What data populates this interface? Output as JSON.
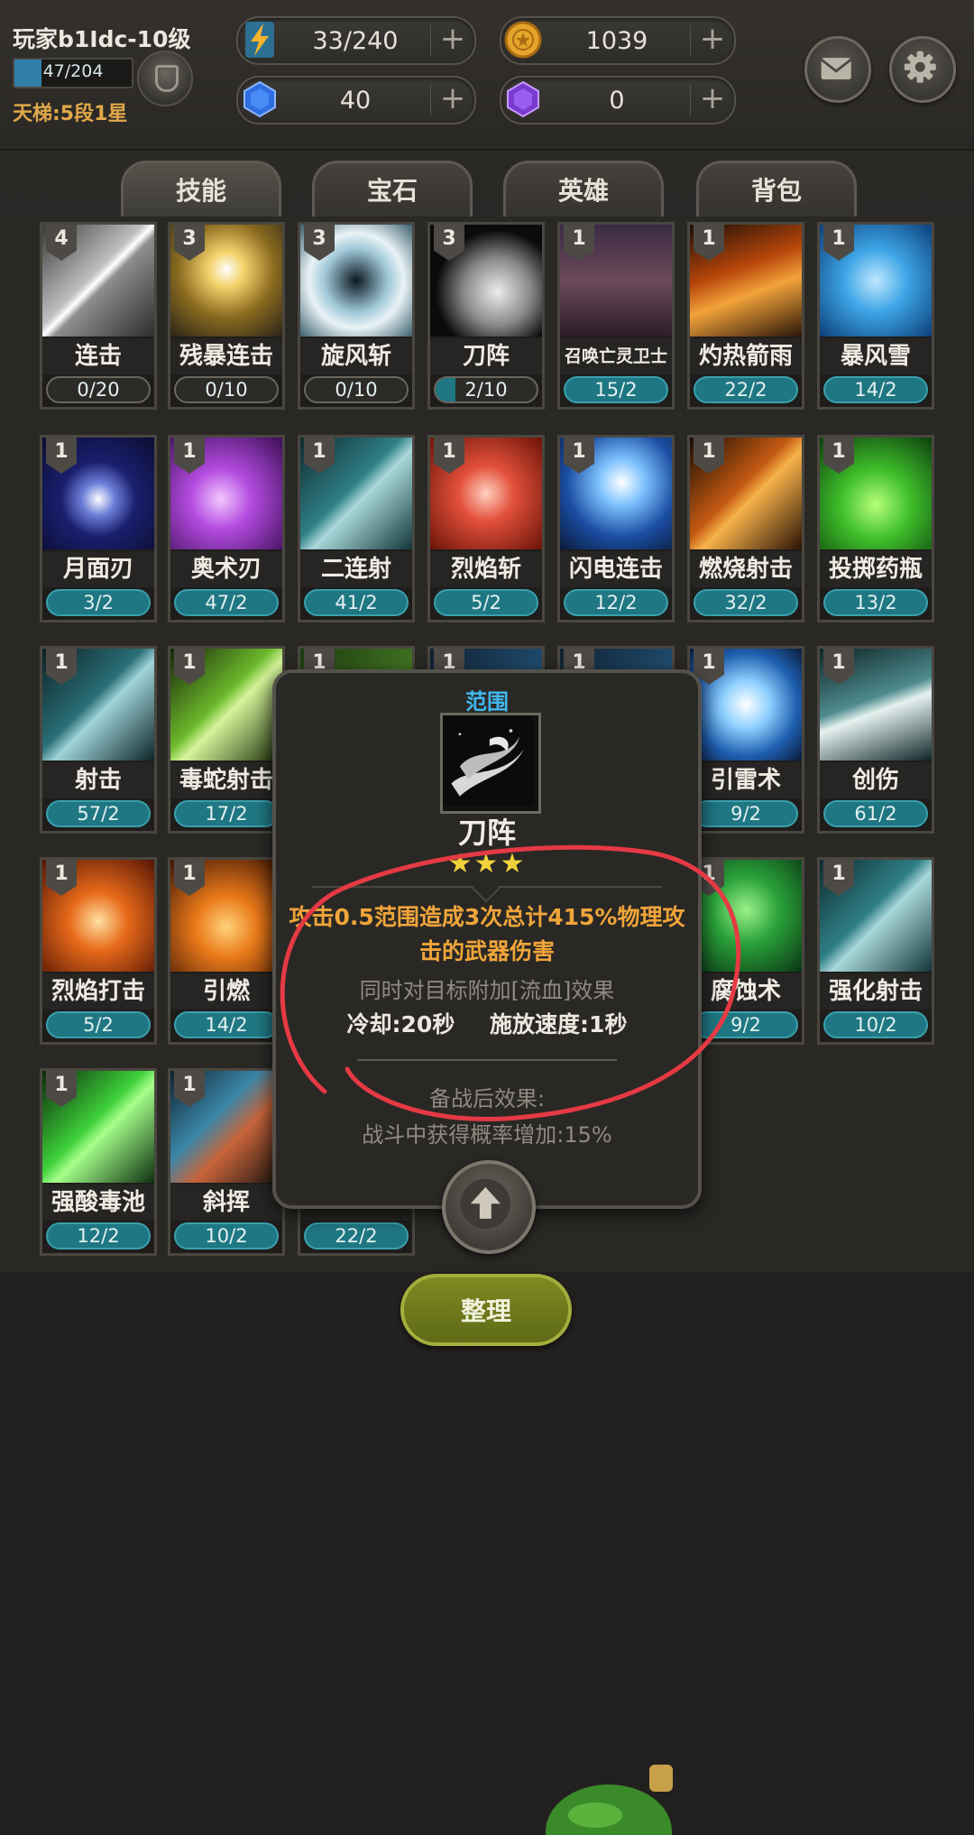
{
  "player": {
    "name": "玩家b1Idc-10级",
    "xp_text": "47/204",
    "xp_fraction": 0.23,
    "ladder": "天梯:5段1星"
  },
  "resources": {
    "energy": "33/240",
    "gold": "1039",
    "gem_blue": "40",
    "gem_purple": "0",
    "plus": "+"
  },
  "tabs": [
    "技能",
    "宝石",
    "英雄",
    "背包"
  ],
  "skills": [
    {
      "name": "连击",
      "level": "4",
      "progress": "0/20",
      "fill": 0,
      "theme": "sword"
    },
    {
      "name": "残暴连击",
      "level": "3",
      "progress": "0/10",
      "fill": 0,
      "theme": "sword-gold"
    },
    {
      "name": "旋风斩",
      "level": "3",
      "progress": "0/10",
      "fill": 0,
      "theme": "whirl"
    },
    {
      "name": "刀阵",
      "level": "3",
      "progress": "2/10",
      "fill": 0.2,
      "theme": "blade"
    },
    {
      "name": "召唤亡灵卫士",
      "level": "1",
      "progress": "15/2",
      "fill": 1,
      "theme": "knight",
      "small": true
    },
    {
      "name": "灼热箭雨",
      "level": "1",
      "progress": "22/2",
      "fill": 1,
      "theme": "fire-arrow"
    },
    {
      "name": "暴风雪",
      "level": "1",
      "progress": "14/2",
      "fill": 1,
      "theme": "ice"
    },
    {
      "name": "月面刃",
      "level": "1",
      "progress": "3/2",
      "fill": 1,
      "theme": "moon"
    },
    {
      "name": "奥术刃",
      "level": "1",
      "progress": "47/2",
      "fill": 1,
      "theme": "arcane"
    },
    {
      "name": "二连射",
      "level": "1",
      "progress": "41/2",
      "fill": 1,
      "theme": "arrow"
    },
    {
      "name": "烈焰斩",
      "level": "1",
      "progress": "5/2",
      "fill": 1,
      "theme": "flame-axe"
    },
    {
      "name": "闪电连击",
      "level": "1",
      "progress": "12/2",
      "fill": 1,
      "theme": "lightning-sword"
    },
    {
      "name": "燃烧射击",
      "level": "1",
      "progress": "32/2",
      "fill": 1,
      "theme": "fire-shot"
    },
    {
      "name": "投掷药瓶",
      "level": "1",
      "progress": "13/2",
      "fill": 1,
      "theme": "potion"
    },
    {
      "name": "射击",
      "level": "1",
      "progress": "57/2",
      "fill": 1,
      "theme": "bow"
    },
    {
      "name": "毒蛇射击",
      "level": "1",
      "progress": "17/2",
      "fill": 1,
      "theme": "poison-arrow"
    },
    {
      "name": "",
      "level": "1",
      "progress": "",
      "fill": 1,
      "theme": "hidden-green"
    },
    {
      "name": "",
      "level": "1",
      "progress": "",
      "fill": 1,
      "theme": "hidden-blue"
    },
    {
      "name": "",
      "level": "1",
      "progress": "",
      "fill": 1,
      "theme": "hidden-blue"
    },
    {
      "name": "引雷术",
      "level": "1",
      "progress": "9/2",
      "fill": 1,
      "theme": "thunder"
    },
    {
      "name": "创伤",
      "level": "1",
      "progress": "61/2",
      "fill": 1,
      "theme": "wound"
    },
    {
      "name": "烈焰打击",
      "level": "1",
      "progress": "5/2",
      "fill": 1,
      "theme": "fire-sword"
    },
    {
      "name": "引燃",
      "level": "1",
      "progress": "14/2",
      "fill": 1,
      "theme": "ignite"
    },
    {
      "name": "",
      "level": "",
      "progress": "",
      "fill": 1,
      "theme": "hidden"
    },
    {
      "name": "",
      "level": "",
      "progress": "",
      "fill": 1,
      "theme": "hidden"
    },
    {
      "name": "",
      "level": "",
      "progress": "",
      "fill": 1,
      "theme": "hidden"
    },
    {
      "name": "腐蚀术",
      "level": "1",
      "progress": "9/2",
      "fill": 1,
      "theme": "corrode"
    },
    {
      "name": "强化射击",
      "level": "1",
      "progress": "10/2",
      "fill": 1,
      "theme": "arrow"
    },
    {
      "name": "强酸毒池",
      "level": "1",
      "progress": "12/2",
      "fill": 1,
      "theme": "acid"
    },
    {
      "name": "斜挥",
      "level": "1",
      "progress": "10/2",
      "fill": 1,
      "theme": "slash"
    },
    {
      "name": "",
      "level": "",
      "progress": "22/2",
      "fill": 1,
      "theme": "hidden"
    }
  ],
  "tooltip": {
    "type": "范围",
    "name": "刀阵",
    "stars": "★★★",
    "desc": "攻击0.5范围造成3次总计415%物理攻击的武器伤害",
    "extra": "同时对目标附加[流血]效果",
    "cooldown": "冷却:20秒",
    "cast_speed": "施放速度:1秒",
    "after_battle_header": "备战后效果:",
    "after_battle_text": "战斗中获得概率增加:15%"
  },
  "sort_button": "整理",
  "colors": {
    "accent_orange": "#f0a53a",
    "type_blue": "#41b7f0",
    "progress_teal": "#1f7783",
    "annotation_red": "#e53a44",
    "sort_green": "#7f8a22"
  }
}
